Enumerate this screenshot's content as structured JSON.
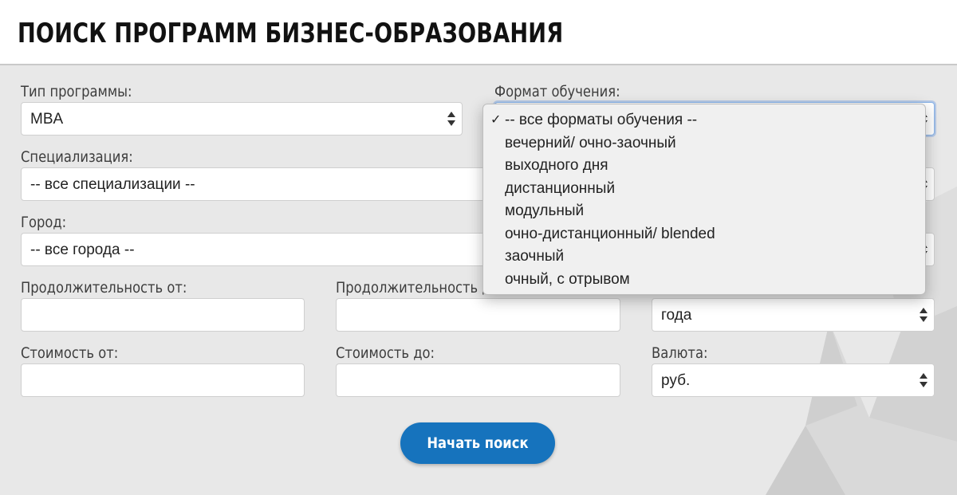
{
  "header": {
    "title": "ПОИСК ПРОГРАММ БИЗНЕС-ОБРАЗОВАНИЯ"
  },
  "form": {
    "program_type": {
      "label": "Тип программы:",
      "value": "MBA"
    },
    "format": {
      "label": "Формат обучения:",
      "value": "-- все форматы обучения --",
      "options": [
        "-- все форматы обучения --",
        "вечерний/ очно-заочный",
        "выходного дня",
        "дистанционный",
        "модульный",
        "очно-дистанционный/ blended",
        "заочный",
        "очный, с отрывом"
      ],
      "checkmark": "✓"
    },
    "specialization": {
      "label": "Специализация:",
      "value": "-- все специализации --"
    },
    "city": {
      "label": "Город:",
      "value": "-- все города --"
    },
    "duration_from": {
      "label": "Продолжительность от:",
      "value": ""
    },
    "duration_to": {
      "label": "Продолжительность до:",
      "value": ""
    },
    "duration_unit": {
      "value": "года"
    },
    "cost_from": {
      "label": "Стоимость от:",
      "value": ""
    },
    "cost_to": {
      "label": "Стоимость до:",
      "value": ""
    },
    "currency": {
      "label": "Валюта:",
      "value": "руб."
    },
    "submit_label": "Начать поиск"
  },
  "colors": {
    "accent": "#1673bd",
    "background": "#e8e8e8"
  }
}
